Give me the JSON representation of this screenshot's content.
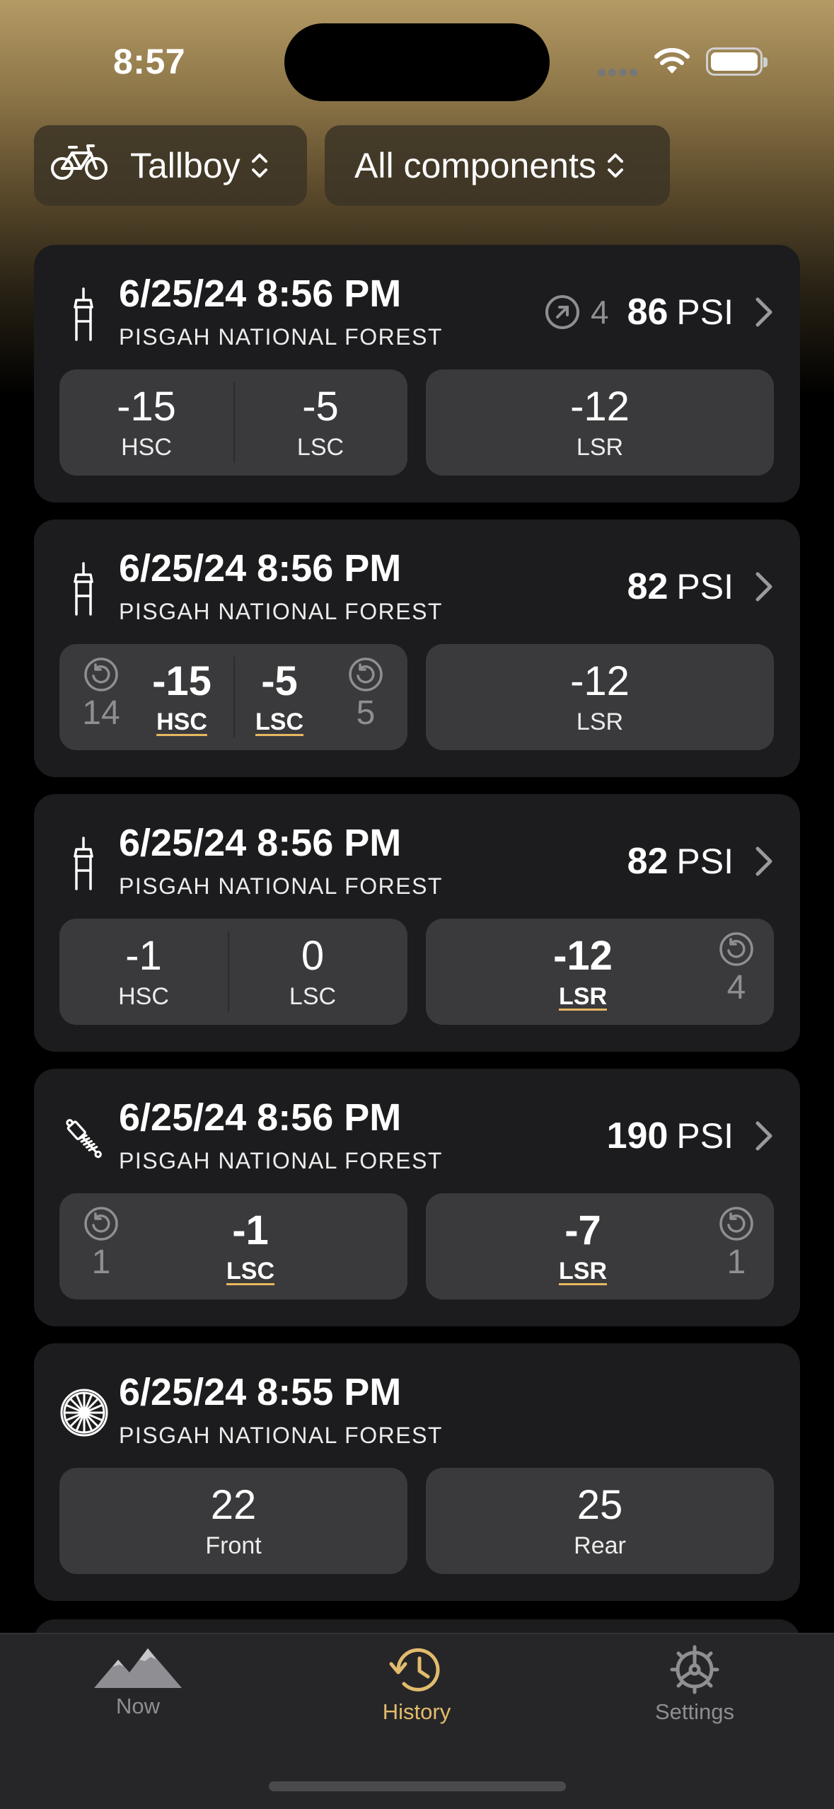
{
  "status_bar": {
    "time": "8:57"
  },
  "filters": {
    "bike": {
      "label": "Tallboy",
      "icon": "bicycle-icon"
    },
    "component": {
      "label": "All components"
    }
  },
  "cards": [
    {
      "icon": "fork-icon",
      "date": "6/25/24 8:56 PM",
      "location": "PISGAH NATIONAL FOREST",
      "sag_count": "4",
      "psi": "86",
      "psi_unit": "PSI",
      "left": {
        "a_value": "-15",
        "a_label": "HSC",
        "b_value": "-5",
        "b_label": "LSC"
      },
      "right": {
        "value": "-12",
        "label": "LSR"
      }
    },
    {
      "icon": "fork-icon",
      "date": "6/25/24 8:56 PM",
      "location": "PISGAH NATIONAL FOREST",
      "psi": "82",
      "psi_unit": "PSI",
      "left": {
        "a_clicks": "14",
        "a_value": "-15",
        "a_label": "HSC",
        "b_value": "-5",
        "b_label": "LSC",
        "b_clicks": "5"
      },
      "right": {
        "value": "-12",
        "label": "LSR"
      }
    },
    {
      "icon": "fork-icon",
      "date": "6/25/24 8:56 PM",
      "location": "PISGAH NATIONAL FOREST",
      "psi": "82",
      "psi_unit": "PSI",
      "left": {
        "a_value": "-1",
        "a_label": "HSC",
        "b_value": "0",
        "b_label": "LSC"
      },
      "right": {
        "value": "-12",
        "label": "LSR",
        "clicks": "4"
      }
    },
    {
      "icon": "rear-shock-icon",
      "date": "6/25/24 8:56 PM",
      "location": "PISGAH NATIONAL FOREST",
      "psi": "190",
      "psi_unit": "PSI",
      "left": {
        "clicks": "1",
        "value": "-1",
        "label": "LSC"
      },
      "right": {
        "value": "-7",
        "label": "LSR",
        "clicks": "1"
      }
    },
    {
      "icon": "wheel-icon",
      "date": "6/25/24 8:55 PM",
      "location": "PISGAH NATIONAL FOREST",
      "left": {
        "value": "22",
        "label": "Front"
      },
      "right": {
        "value": "25",
        "label": "Rear"
      }
    }
  ],
  "tabs": [
    {
      "label": "Now",
      "icon": "mountains-icon"
    },
    {
      "label": "History",
      "icon": "history-clock-icon",
      "active": true
    },
    {
      "label": "Settings",
      "icon": "gear-icon"
    }
  ],
  "colors": {
    "accent": "#e2bc6c",
    "card": "#1c1c1e",
    "box": "#3a3a3c"
  }
}
